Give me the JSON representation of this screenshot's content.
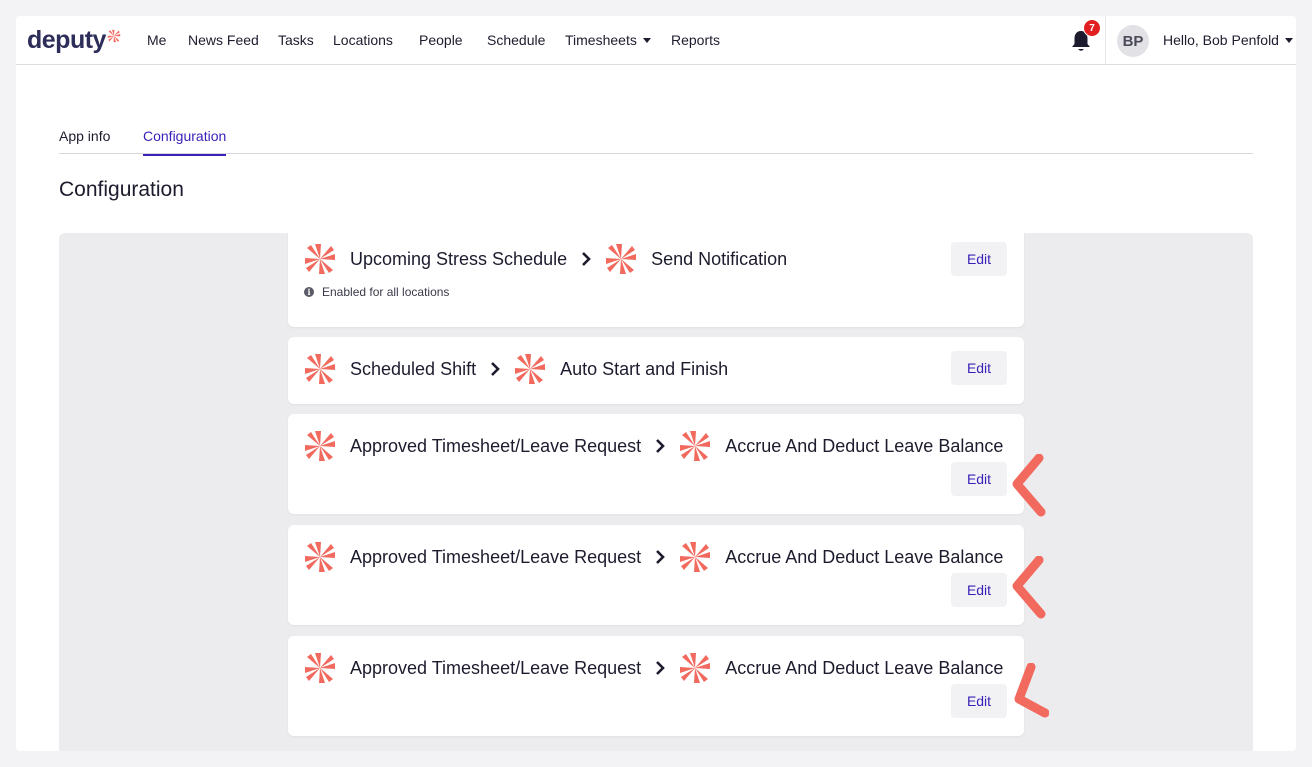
{
  "brand": {
    "name": "deputy",
    "accent": "#f26a5e",
    "primary": "#3a1fb8"
  },
  "nav": {
    "items": [
      {
        "id": "me",
        "label": "Me"
      },
      {
        "id": "news-feed",
        "label": "News Feed"
      },
      {
        "id": "tasks",
        "label": "Tasks"
      },
      {
        "id": "locations",
        "label": "Locations"
      },
      {
        "id": "people",
        "label": "People"
      },
      {
        "id": "schedule",
        "label": "Schedule"
      },
      {
        "id": "timesheets",
        "label": "Timesheets"
      },
      {
        "id": "reports",
        "label": "Reports"
      }
    ],
    "notifications": {
      "icon": "bell-icon",
      "count": "7"
    },
    "user": {
      "initials": "BP",
      "greeting": "Hello, Bob Penfold"
    }
  },
  "tabs": [
    {
      "label": "App info",
      "active": false
    },
    {
      "label": "Configuration",
      "active": true
    }
  ],
  "page_title": "Configuration",
  "rules": [
    {
      "trigger": "Upcoming Stress Schedule",
      "action": "Send Notification",
      "edit_label": "Edit",
      "note": "Enabled for all locations"
    },
    {
      "trigger": "Scheduled Shift",
      "action": "Auto Start and Finish",
      "edit_label": "Edit"
    },
    {
      "trigger": "Approved Timesheet/Leave Request",
      "action": "Accrue And Deduct Leave Balance",
      "edit_label": "Edit",
      "highlighted": true
    },
    {
      "trigger": "Approved Timesheet/Leave Request",
      "action": "Accrue And Deduct Leave Balance",
      "edit_label": "Edit",
      "highlighted": true
    },
    {
      "trigger": "Approved Timesheet/Leave Request",
      "action": "Accrue And Deduct Leave Balance",
      "edit_label": "Edit",
      "highlighted": true
    }
  ]
}
